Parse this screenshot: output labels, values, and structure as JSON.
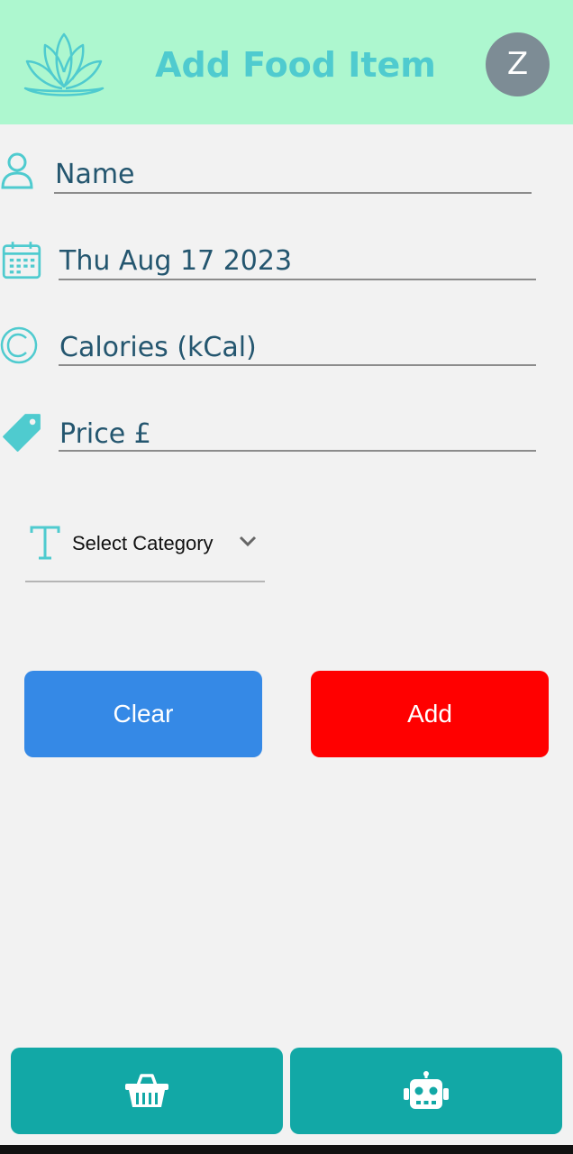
{
  "header": {
    "title": "Add Food Item",
    "avatar_letter": "Z",
    "logo_icon": "lotus-icon",
    "background": "#adf7cf",
    "title_color": "#4fcbcf"
  },
  "form": {
    "name": {
      "icon": "person-icon",
      "placeholder": "Name"
    },
    "date": {
      "icon": "calendar-icon",
      "value": "Thu Aug 17 2023"
    },
    "calories": {
      "icon": "copyright-c-icon",
      "placeholder": "Calories (kCal)"
    },
    "price": {
      "icon": "price-tag-icon",
      "placeholder": "Price £"
    },
    "category": {
      "icon": "text-t-icon",
      "label": "Select Category",
      "caret_icon": "chevron-down-icon"
    }
  },
  "buttons": {
    "clear_label": "Clear",
    "add_label": "Add",
    "clear_color": "#3589e6",
    "add_color": "#ff0000"
  },
  "bottom_nav": {
    "left_icon": "shopping-basket-icon",
    "right_icon": "robot-icon",
    "color": "#12a8a6"
  }
}
